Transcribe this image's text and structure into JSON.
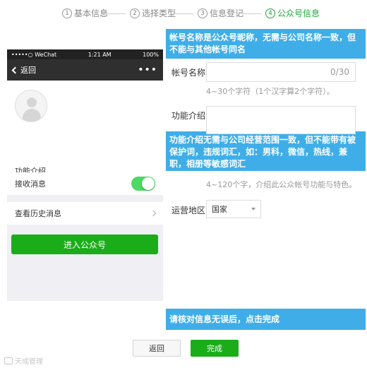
{
  "stepper": {
    "steps": [
      {
        "num": "1",
        "label": "基本信息"
      },
      {
        "num": "2",
        "label": "选择类型"
      },
      {
        "num": "3",
        "label": "信息登记"
      },
      {
        "num": "4",
        "label": "公众号信息"
      }
    ],
    "active_index": 3
  },
  "phone": {
    "status": {
      "carrier": "•••••○ WeChat",
      "time": "1:21 AM",
      "battery": "100%"
    },
    "nav": {
      "back_label": "返回",
      "more": "•••"
    },
    "intro_label": "功能介绍",
    "receive_label": "接收消息",
    "history_label": "查看历史消息",
    "enter_label": "进入公众号"
  },
  "tips": {
    "name_tip": "帐号名称是公众号昵称，无需与公司名称一致，但不能与其他帐号同名",
    "intro_tip": "功能介绍无需与公司经营范围一致，但不能带有被保护词，违规词汇，如：男科，微信，热线，兼职，相册等敏感词汇",
    "confirm_tip": "请核对信息无误后，点击完成"
  },
  "form": {
    "name_label": "帐号名称",
    "name_counter": "0/30",
    "name_hint": "4~30个字符（1个汉字算2个字符）。",
    "intro_label": "功能介绍",
    "intro_hint": "4~120个字，介绍此公众帐号功能与特色。",
    "region_label": "运营地区",
    "region_value": "国家"
  },
  "buttons": {
    "back": "返回",
    "done": "完成"
  },
  "watermark": "天成管理",
  "colors": {
    "accent": "#1aad19",
    "tip": "#3faee8",
    "stepper_active": "#1fa83a"
  }
}
